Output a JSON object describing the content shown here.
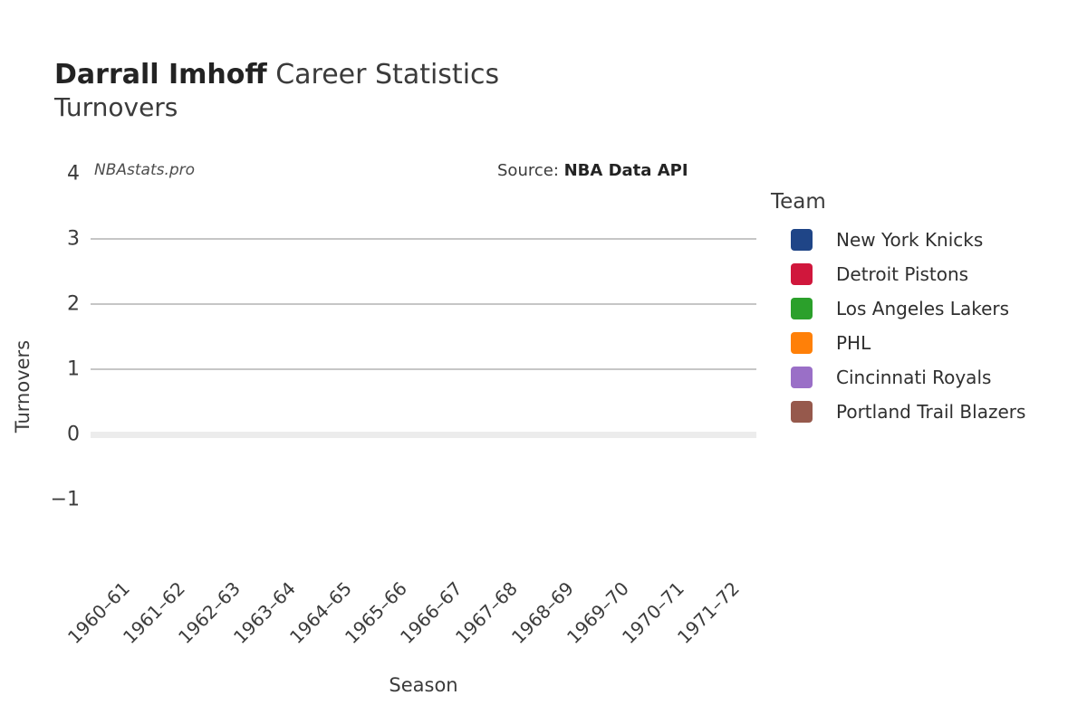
{
  "header": {
    "player_name": "Darrall Imhoff",
    "title_suffix": " Career Statistics",
    "subtitle": "Turnovers"
  },
  "watermark": "NBAstats.pro",
  "source": {
    "prefix": "Source: ",
    "value": "NBA Data API"
  },
  "legend": {
    "title": "Team",
    "items": [
      {
        "label": "New York Knicks",
        "color": "#1f4587"
      },
      {
        "label": "Detroit Pistons",
        "color": "#d0173c"
      },
      {
        "label": "Los Angeles Lakers",
        "color": "#2ba02b"
      },
      {
        "label": "PHL",
        "color": "#ff8008"
      },
      {
        "label": "Cincinnati Royals",
        "color": "#9a6fc7"
      },
      {
        "label": "Portland Trail Blazers",
        "color": "#96594c"
      }
    ]
  },
  "axes": {
    "x_label": "Season",
    "y_label": "Turnovers",
    "y_ticks": [
      "4",
      "3",
      "2",
      "1",
      "0",
      "−1"
    ]
  },
  "chart_data": {
    "type": "bar",
    "title": "Darrall Imhoff Career Statistics — Turnovers",
    "xlabel": "Season",
    "ylabel": "Turnovers",
    "ylim": [
      -1,
      4
    ],
    "y_ticks": [
      4,
      3,
      2,
      1,
      0,
      -1
    ],
    "grid": true,
    "grid_axis": "y",
    "legend_title": "Team",
    "legend_position": "right",
    "categories": [
      "1960–61",
      "1961–62",
      "1962–63",
      "1963–64",
      "1964–65",
      "1965–66",
      "1966–67",
      "1967–68",
      "1968–69",
      "1969–70",
      "1970–71",
      "1971–72"
    ],
    "values": [
      0,
      0,
      0,
      0,
      0,
      0,
      0,
      0,
      0,
      0,
      0,
      0
    ],
    "bar_teams": [
      "New York Knicks",
      "New York Knicks",
      "Detroit Pistons",
      "Detroit Pistons",
      "Los Angeles Lakers",
      "Los Angeles Lakers",
      "Los Angeles Lakers",
      "PHL",
      "Cincinnati Royals",
      "Cincinnati Royals",
      "Portland Trail Blazers",
      "Portland Trail Blazers"
    ],
    "series": [
      {
        "name": "New York Knicks",
        "color": "#1f4587",
        "values": [
          0,
          0,
          null,
          null,
          null,
          null,
          null,
          null,
          null,
          null,
          null,
          null
        ]
      },
      {
        "name": "Detroit Pistons",
        "color": "#d0173c",
        "values": [
          null,
          null,
          0,
          0,
          null,
          null,
          null,
          null,
          null,
          null,
          null,
          null
        ]
      },
      {
        "name": "Los Angeles Lakers",
        "color": "#2ba02b",
        "values": [
          null,
          null,
          null,
          null,
          0,
          0,
          0,
          null,
          null,
          null,
          null,
          null
        ]
      },
      {
        "name": "PHL",
        "color": "#ff8008",
        "values": [
          null,
          null,
          null,
          null,
          null,
          null,
          null,
          0,
          null,
          null,
          null,
          null
        ]
      },
      {
        "name": "Cincinnati Royals",
        "color": "#9a6fc7",
        "values": [
          null,
          null,
          null,
          null,
          null,
          null,
          null,
          null,
          0,
          0,
          null,
          null
        ]
      },
      {
        "name": "Portland Trail Blazers",
        "color": "#96594c",
        "values": [
          null,
          null,
          null,
          null,
          null,
          null,
          null,
          null,
          null,
          null,
          0,
          0
        ]
      }
    ],
    "annotations": [
      {
        "text": "NBAstats.pro",
        "position": "top-left"
      },
      {
        "text": "Source: NBA Data API",
        "position": "top-center"
      }
    ],
    "note": "All plotted turnover values are 0 — no bars are visible above the zero baseline."
  }
}
